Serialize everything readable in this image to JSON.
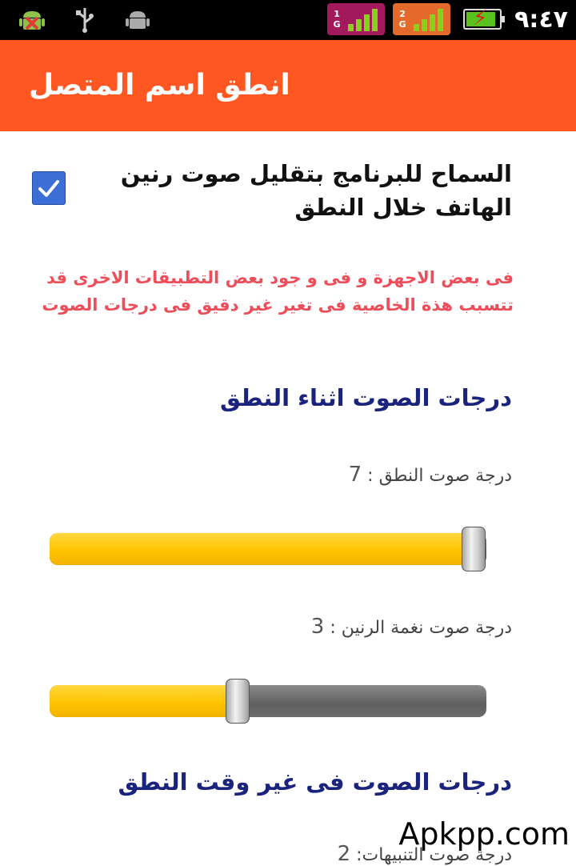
{
  "status_bar": {
    "left_icons": [
      "android-debug-icon",
      "usb-icon",
      "android-icon"
    ],
    "sim1_label": "1\nG",
    "sim2_label": "2\nG",
    "time": "٩:٤٧"
  },
  "header": {
    "title": "انطق اسم المتصل"
  },
  "settings": {
    "reduce_ringtone": {
      "label": "السماح للبرنامج بتقليل صوت رنين الهاتف خلال النطق",
      "checked": true
    },
    "warning": "فى بعض الاجهزة و فى و جود بعض التطبيقات الاخرى قد تتسبب هذة الخاصية فى تغير غير دقيق فى درجات الصوت"
  },
  "section_speaking": {
    "title": "درجات الصوت اثناء النطق",
    "speech_volume": {
      "label": "درجة صوت النطق : ",
      "value": "7",
      "fraction": 0.97
    },
    "ringtone_volume": {
      "label": "درجة صوت نغمة الرنين : ",
      "value": "3",
      "fraction": 0.43
    }
  },
  "section_idle": {
    "title": "درجات الصوت فى غير وقت النطق",
    "notification_volume": {
      "label": "درجة صوت التنبيهات: ",
      "value": "2"
    }
  },
  "watermark": "Apkpp.com",
  "colors": {
    "accent": "#ff5722",
    "header_text": "#1a237e",
    "warning": "#ee4d5a",
    "slider_fill": "#ffc400"
  }
}
